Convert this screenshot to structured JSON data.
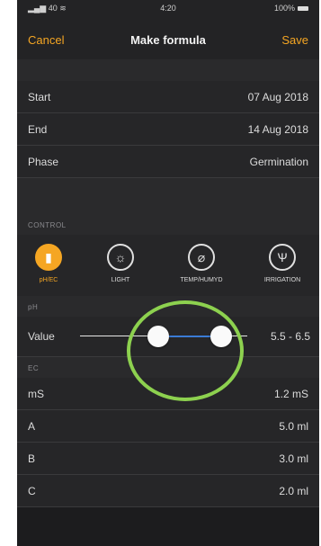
{
  "status": {
    "left": "40",
    "time": "4:20",
    "battery": "100%"
  },
  "nav": {
    "cancel": "Cancel",
    "title": "Make formula",
    "save": "Save"
  },
  "info": [
    {
      "key": "Start",
      "value": "07 Aug 2018"
    },
    {
      "key": "End",
      "value": "14 Aug 2018"
    },
    {
      "key": "Phase",
      "value": "Germination"
    }
  ],
  "control": {
    "header": "CONTROL",
    "items": [
      {
        "label": "pH/EC",
        "icon": "phec-icon"
      },
      {
        "label": "LIGHT",
        "icon": "sun-icon"
      },
      {
        "label": "TEMP/HUMYD",
        "icon": "thermometer-icon"
      },
      {
        "label": "IRRIGATION",
        "icon": "irrigation-icon"
      }
    ]
  },
  "ph": {
    "header": "pH",
    "label": "Value",
    "range": "5.5 - 6.5"
  },
  "ec": {
    "header": "EC",
    "rows": [
      {
        "key": "mS",
        "value": "1.2 mS"
      },
      {
        "key": "A",
        "value": "5.0 ml"
      },
      {
        "key": "B",
        "value": "3.0 ml"
      },
      {
        "key": "C",
        "value": "2.0 ml"
      }
    ]
  },
  "colors": {
    "accent": "#f5a623",
    "highlight": "#8dd14f",
    "range": "#3a7bd5"
  }
}
